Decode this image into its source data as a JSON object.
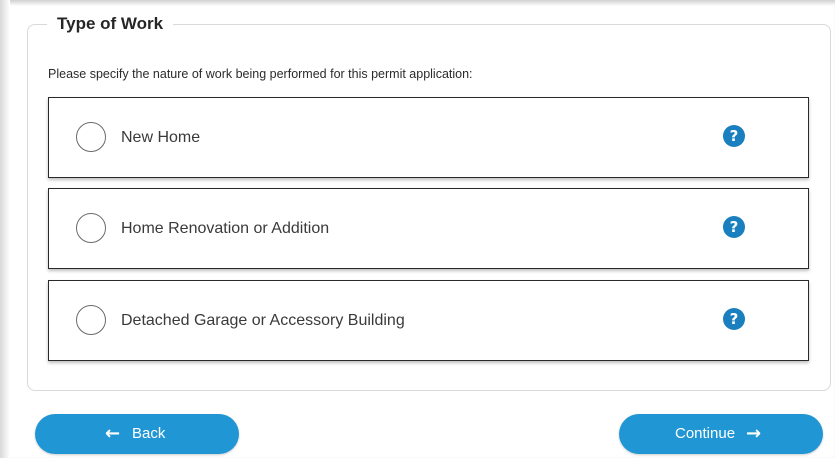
{
  "section": {
    "legend": "Type of Work",
    "instructions": "Please specify the nature of work being performed for this permit application:"
  },
  "options": [
    {
      "label": "New Home",
      "selected": false,
      "help_glyph": "?"
    },
    {
      "label": "Home Renovation or Addition",
      "selected": false,
      "help_glyph": "?"
    },
    {
      "label": "Detached Garage or Accessory Building",
      "selected": false,
      "help_glyph": "?"
    }
  ],
  "buttons": {
    "back_label": "Back",
    "back_icon": "arrow-left-icon",
    "continue_label": "Continue",
    "continue_icon": "arrow-right-icon"
  },
  "colors": {
    "accent": "#2196d4",
    "help_icon": "#1a7fbf",
    "option_border": "#2a2a2a"
  }
}
